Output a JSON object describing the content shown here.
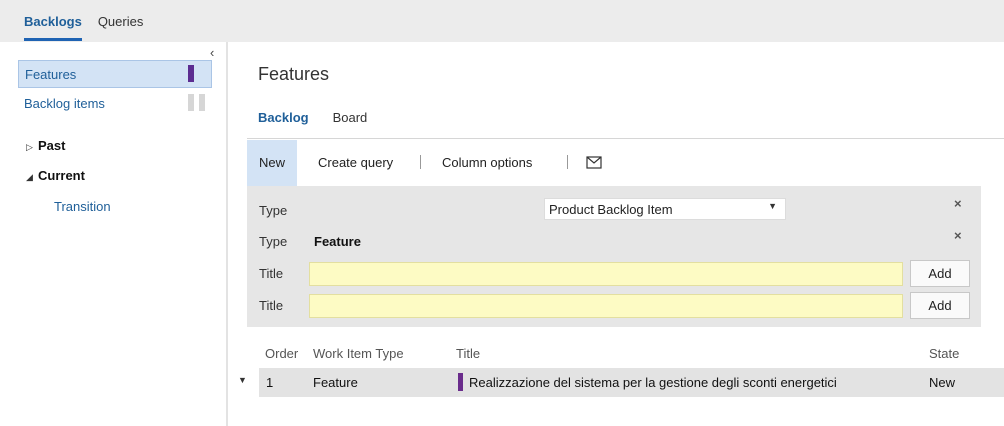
{
  "topnav": {
    "tabs": [
      {
        "label": "Backlogs",
        "active": true
      },
      {
        "label": "Queries",
        "active": false
      }
    ]
  },
  "sidebar": {
    "collapse_icon": "chevron-left-icon",
    "items": [
      {
        "label": "Features",
        "selected": true,
        "color": "#5c2d91"
      },
      {
        "label": "Backlog items",
        "selected": false,
        "color": "#d6d6d6"
      }
    ],
    "tree": [
      {
        "label": "Past",
        "expanded": false
      },
      {
        "label": "Current",
        "expanded": true,
        "children": [
          {
            "label": "Transition"
          }
        ]
      }
    ]
  },
  "main": {
    "title": "Features",
    "tabs": [
      {
        "label": "Backlog",
        "active": true
      },
      {
        "label": "Board",
        "active": false
      }
    ],
    "toolbar": {
      "new_label": "New",
      "create_query_label": "Create query",
      "column_options_label": "Column options",
      "email_icon": "email-icon"
    }
  },
  "quick_add": {
    "rows": [
      {
        "label": "Type",
        "select_value": "Product Backlog Item"
      },
      {
        "label": "Type",
        "value": "Feature"
      },
      {
        "label": "Title",
        "input_value": "",
        "button": "Add"
      },
      {
        "label": "Title",
        "input_value": "",
        "button": "Add"
      }
    ],
    "close_icon": "close-icon"
  },
  "grid": {
    "columns": [
      "Order",
      "Work Item Type",
      "Title",
      "State"
    ],
    "rows": [
      {
        "order": "1",
        "type": "Feature",
        "title": "Realizzazione del sistema per la gestione degli sconti energetici",
        "state": "New",
        "color": "#6a2c8c"
      }
    ]
  }
}
